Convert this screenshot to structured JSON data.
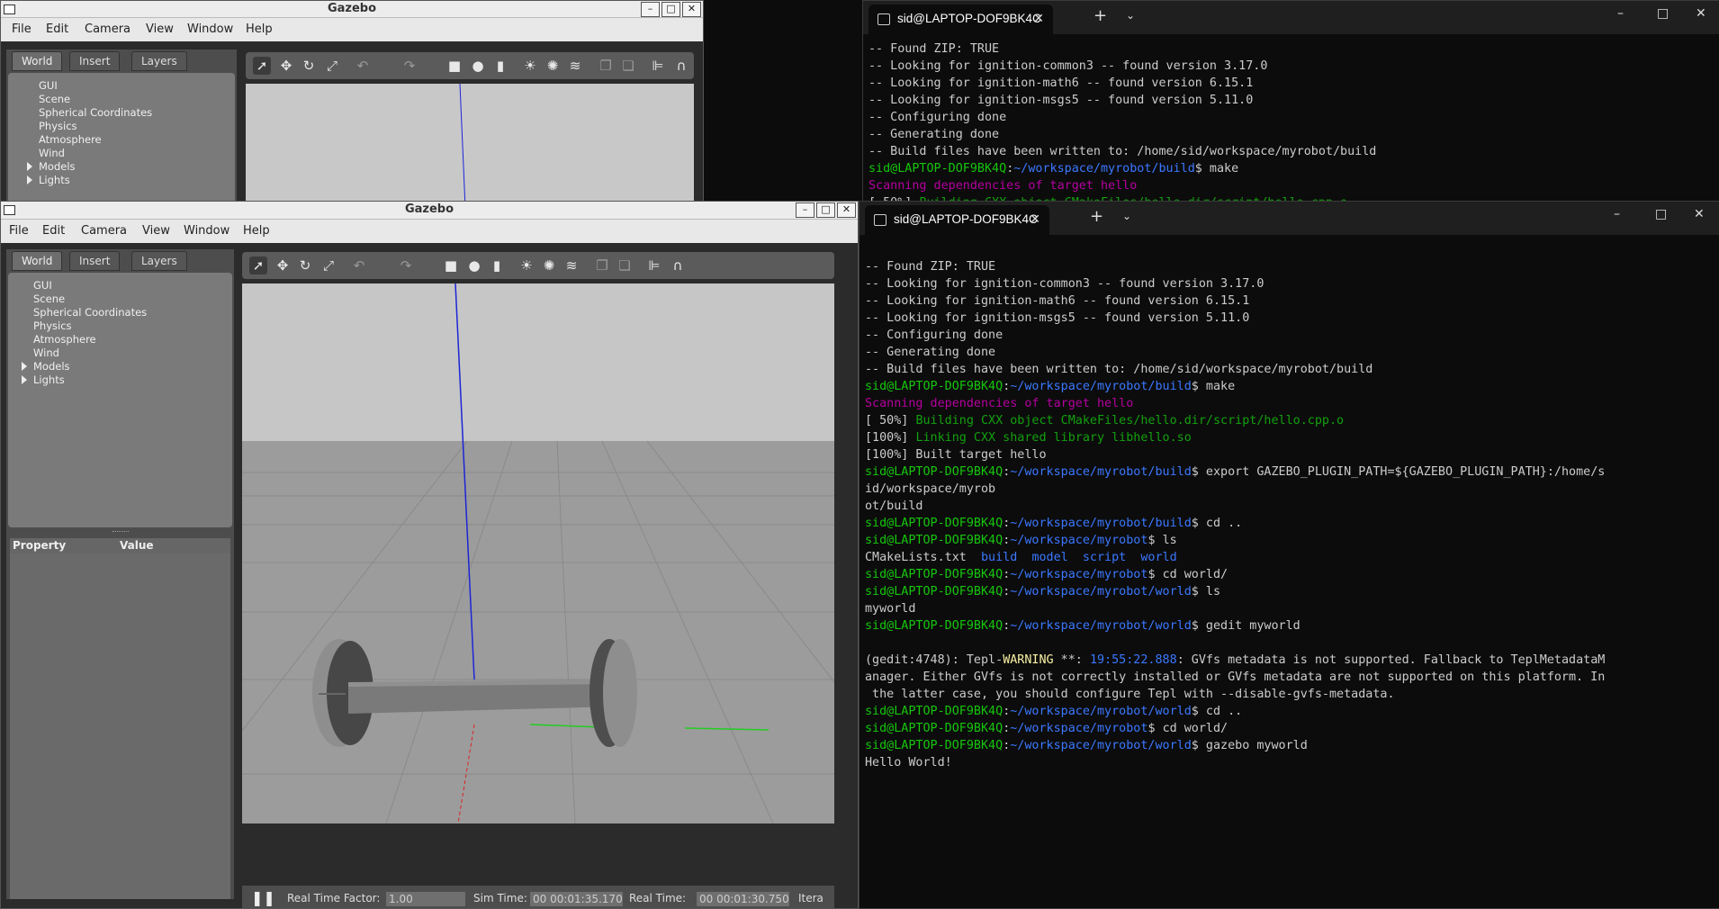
{
  "gazebo": {
    "title": "Gazebo",
    "menu": [
      "File",
      "Edit",
      "Camera",
      "View",
      "Window",
      "Help"
    ],
    "tabs": [
      "World",
      "Insert",
      "Layers"
    ],
    "tree": [
      "GUI",
      "Scene",
      "Spherical Coordinates",
      "Physics",
      "Atmosphere",
      "Wind",
      "Models",
      "Lights"
    ],
    "props": {
      "property": "Property",
      "value": "Value"
    },
    "status": {
      "rtf_label": "Real Time Factor:",
      "rtf": "1.00",
      "sim_label": "Sim Time:",
      "sim": "00 00:01:35.170",
      "real_label": "Real Time:",
      "real": "00 00:01:30.750",
      "iter_label": "Itera"
    }
  },
  "terminal": {
    "tab_title": "sid@LAPTOP-DOF9BK4C",
    "back_lines": [
      "-- Found ZIP: TRUE",
      "-- Looking for ignition-common3 -- found version 3.17.0",
      "-- Looking for ignition-math6 -- found version 6.15.1",
      "-- Looking for ignition-msgs5 -- found version 5.11.0",
      "-- Configuring done",
      "-- Generating done",
      "-- Build files have been written to: /home/sid/workspace/myrobot/build"
    ],
    "prompt_user": "sid@LAPTOP-DOF9BK4Q",
    "path_build": "~/workspace/myrobot/build",
    "path_root": "~/workspace/myrobot",
    "path_world": "~/workspace/myrobot/world",
    "cmd_make": "make",
    "scan": "Scanning dependencies of target hello",
    "build_pct": "[ 50%]",
    "build_msg": "Building CXX object CMakeFiles/hello.dir/script/hello.cpp.o",
    "link_pct": "[100%]",
    "link_msg": "Linking CXX shared library libhello.so",
    "built": "[100%] Built target hello",
    "cmd_export": "export GAZEBO_PLUGIN_PATH=${GAZEBO_PLUGIN_PATH}:/home/s",
    "export_cont1": "id/workspace/myrob",
    "export_cont2": "ot/build",
    "cmd_cdup": "cd ..",
    "cmd_ls": "ls",
    "ls_files": [
      "CMakeLists.txt",
      "build",
      "model",
      "script",
      "world"
    ],
    "cmd_cdworld": "cd world/",
    "ls_world": "myworld",
    "cmd_gedit": "gedit myworld",
    "warn_pre": "(gedit:4748): Tepl-",
    "warn_word": "WARNING",
    "warn_mid": " **: ",
    "warn_time": "19:55:22.888",
    "warn_post": ": GVfs metadata is not supported. Fallback to TeplMetadataM",
    "warn_2": "anager. Either GVfs is not correctly installed or GVfs metadata are not supported on this platform. In",
    "warn_3": " the latter case, you should configure Tepl with --disable-gvfs-metadata.",
    "cmd_gazebo": "gazebo myworld",
    "hello": "Hello World!"
  }
}
